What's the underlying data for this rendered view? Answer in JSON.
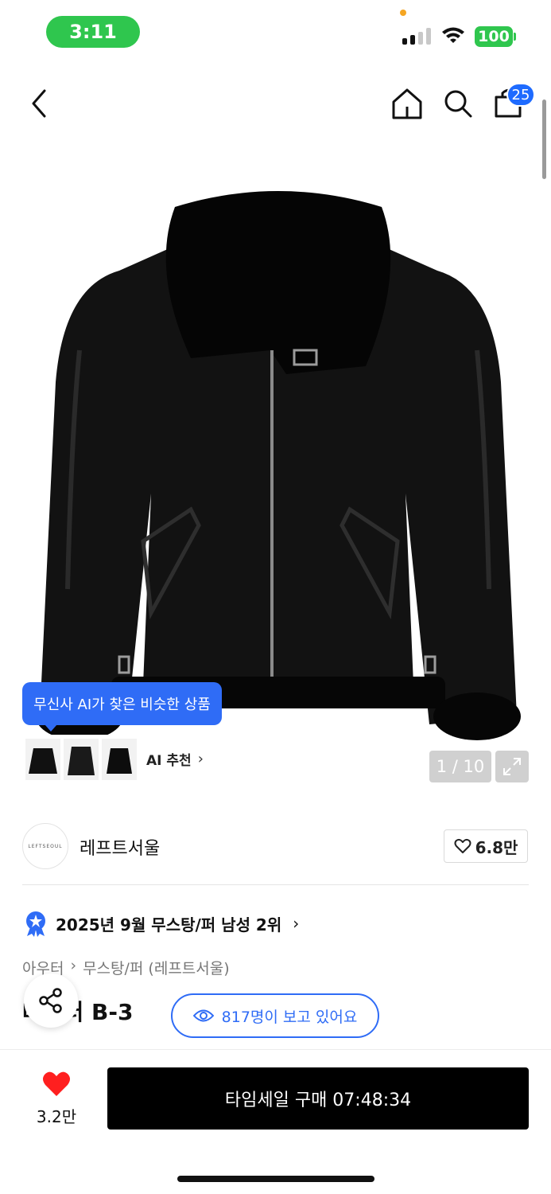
{
  "status_bar": {
    "time": "3:11",
    "battery": "100"
  },
  "header": {
    "cart_count": "25"
  },
  "gallery": {
    "ai_tooltip": "무신사 AI가 찾은 비슷한 상품",
    "ai_reco_label": "AI 추천",
    "counter": "1 / 10"
  },
  "brand": {
    "logo_text": "LEFTSEOUL",
    "name": "레프트서울",
    "likes": "6.8만"
  },
  "ranking": {
    "text": "2025년 9월 무스탕/퍼 남성 2위"
  },
  "breadcrumb": [
    "아우터",
    "무스탕/퍼 (레프트서울)"
  ],
  "product": {
    "title_visible": "데이터 B-3"
  },
  "viewers": {
    "text": "817명이 보고 있어요"
  },
  "bottom": {
    "fav_count": "3.2만",
    "buy_label": "타임세일 구매 07:48:34"
  },
  "colors": {
    "accent_blue": "#2f6cf6",
    "status_green": "#2fc64e",
    "heart_red": "#ff1f1f"
  }
}
